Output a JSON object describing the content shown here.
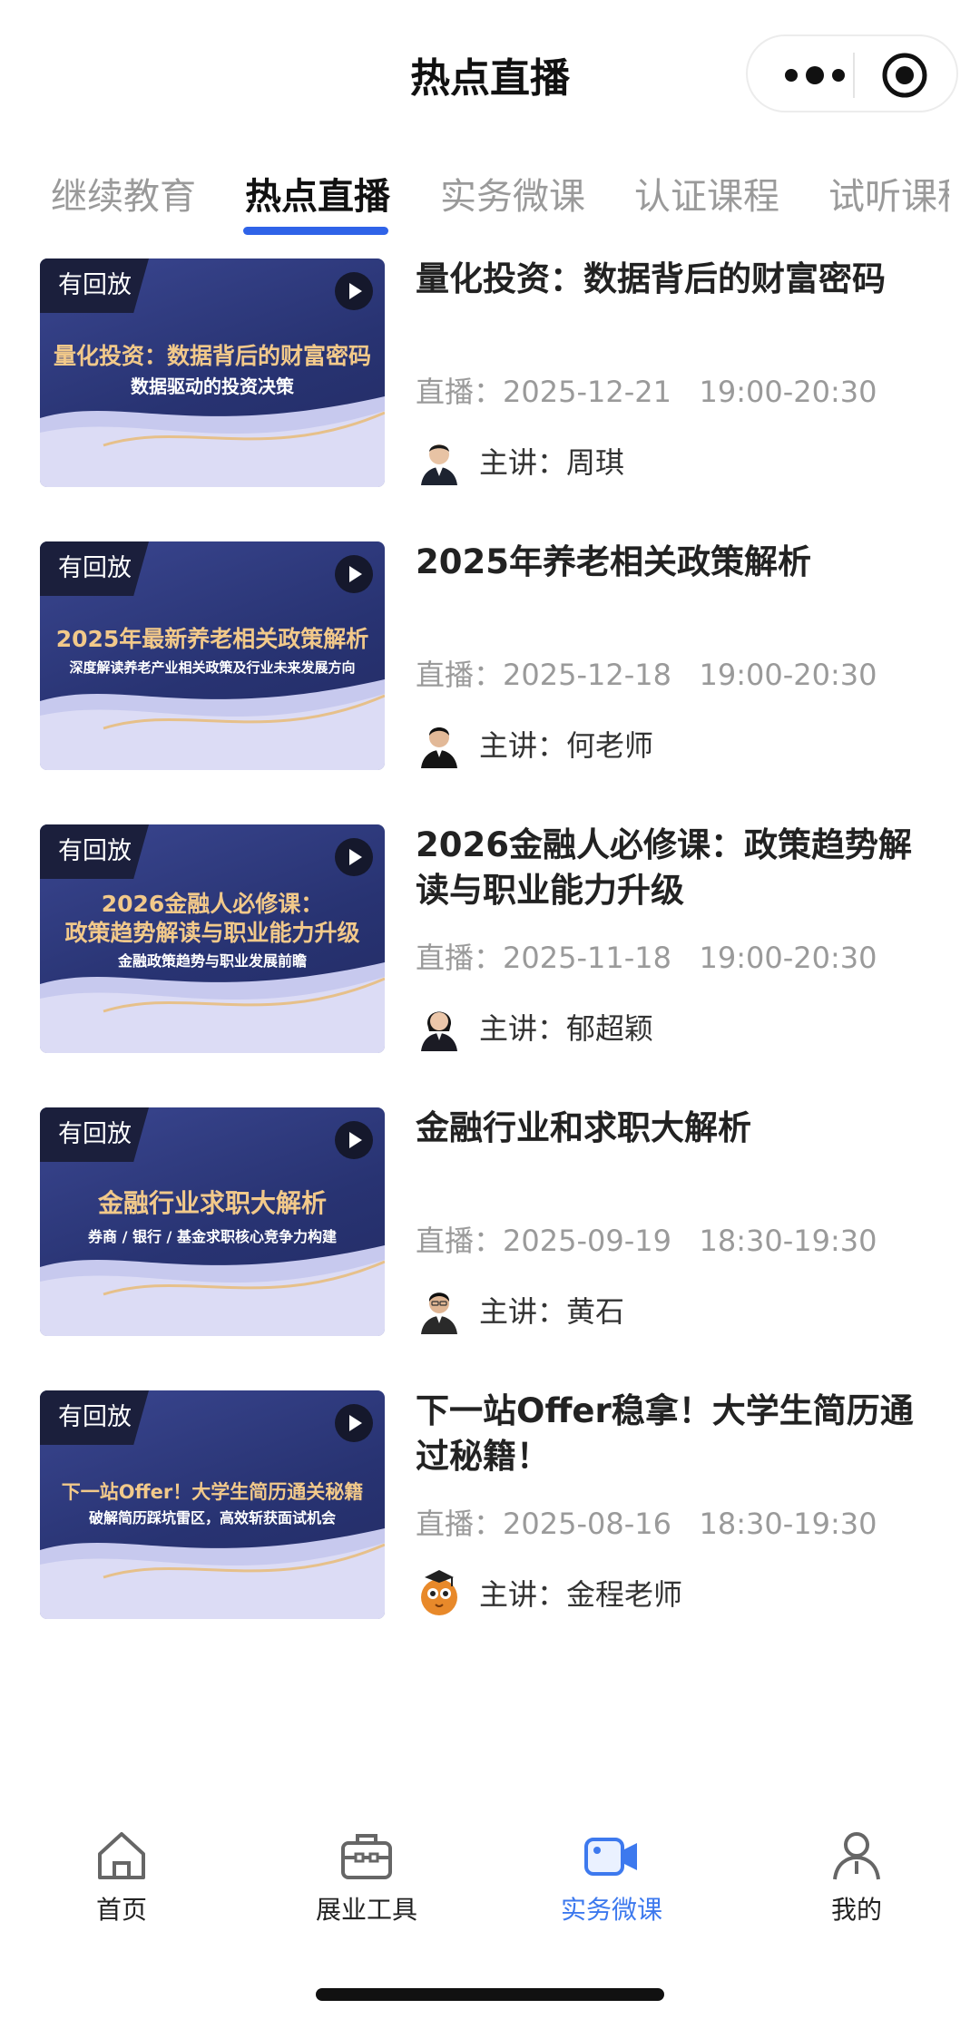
{
  "header": {
    "title": "热点直播",
    "more_icon": "more-dots-icon",
    "close_icon": "target-circle-icon"
  },
  "tabs": [
    {
      "label": "继续教育",
      "active": false
    },
    {
      "label": "热点直播",
      "active": true
    },
    {
      "label": "实务微课",
      "active": false
    },
    {
      "label": "认证课程",
      "active": false
    },
    {
      "label": "试听课程",
      "active": false
    }
  ],
  "items": [
    {
      "badge": "有回放",
      "thumb_title": "量化投资：数据背后的财富密码",
      "thumb_subtitle": "数据驱动的投资决策",
      "title": "量化投资：数据背后的财富密码",
      "time": "直播：2025-12-21   19:00-20:30",
      "speaker": "主讲：周琪"
    },
    {
      "badge": "有回放",
      "thumb_title": "2025年最新养老相关政策解析",
      "thumb_subtitle": "深度解读养老产业相关政策及行业未来发展方向",
      "title": "2025年养老相关政策解析",
      "time": "直播：2025-12-18   19:00-20:30",
      "speaker": "主讲：何老师"
    },
    {
      "badge": "有回放",
      "thumb_title": "2026金融人必修课：",
      "thumb_title_2": "政策趋势解读与职业能力升级",
      "thumb_subtitle": "金融政策趋势与职业发展前瞻",
      "title": "2026金融人必修课：政策趋势解读与职业能力升级",
      "time": "直播：2025-11-18   19:00-20:30",
      "speaker": "主讲：郁超颖"
    },
    {
      "badge": "有回放",
      "thumb_title": "金融行业求职大解析",
      "thumb_subtitle": "券商 / 银行 / 基金求职核心竞争力构建",
      "title": "金融行业和求职大解析",
      "time": "直播：2025-09-19   18:30-19:30",
      "speaker": "主讲：黄石"
    },
    {
      "badge": "有回放",
      "thumb_title": "下一站Offer！大学生简历通关秘籍",
      "thumb_subtitle": "破解简历踩坑雷区，高效斩获面试机会",
      "title": "下一站Offer稳拿！大学生简历通过秘籍！",
      "time": "直播：2025-08-16   18:30-19:30",
      "speaker": "主讲：金程老师"
    }
  ],
  "nav": [
    {
      "label": "首页",
      "icon": "home-icon",
      "active": false
    },
    {
      "label": "展业工具",
      "icon": "toolbox-icon",
      "active": false
    },
    {
      "label": "实务微课",
      "icon": "video-camera-icon",
      "active": true
    },
    {
      "label": "我的",
      "icon": "user-icon",
      "active": false
    }
  ],
  "colors": {
    "accent": "#2f63e8",
    "nav_active": "#3d79ee",
    "thumb_bg": "#283372",
    "thumb_title": "#f2c98a"
  }
}
